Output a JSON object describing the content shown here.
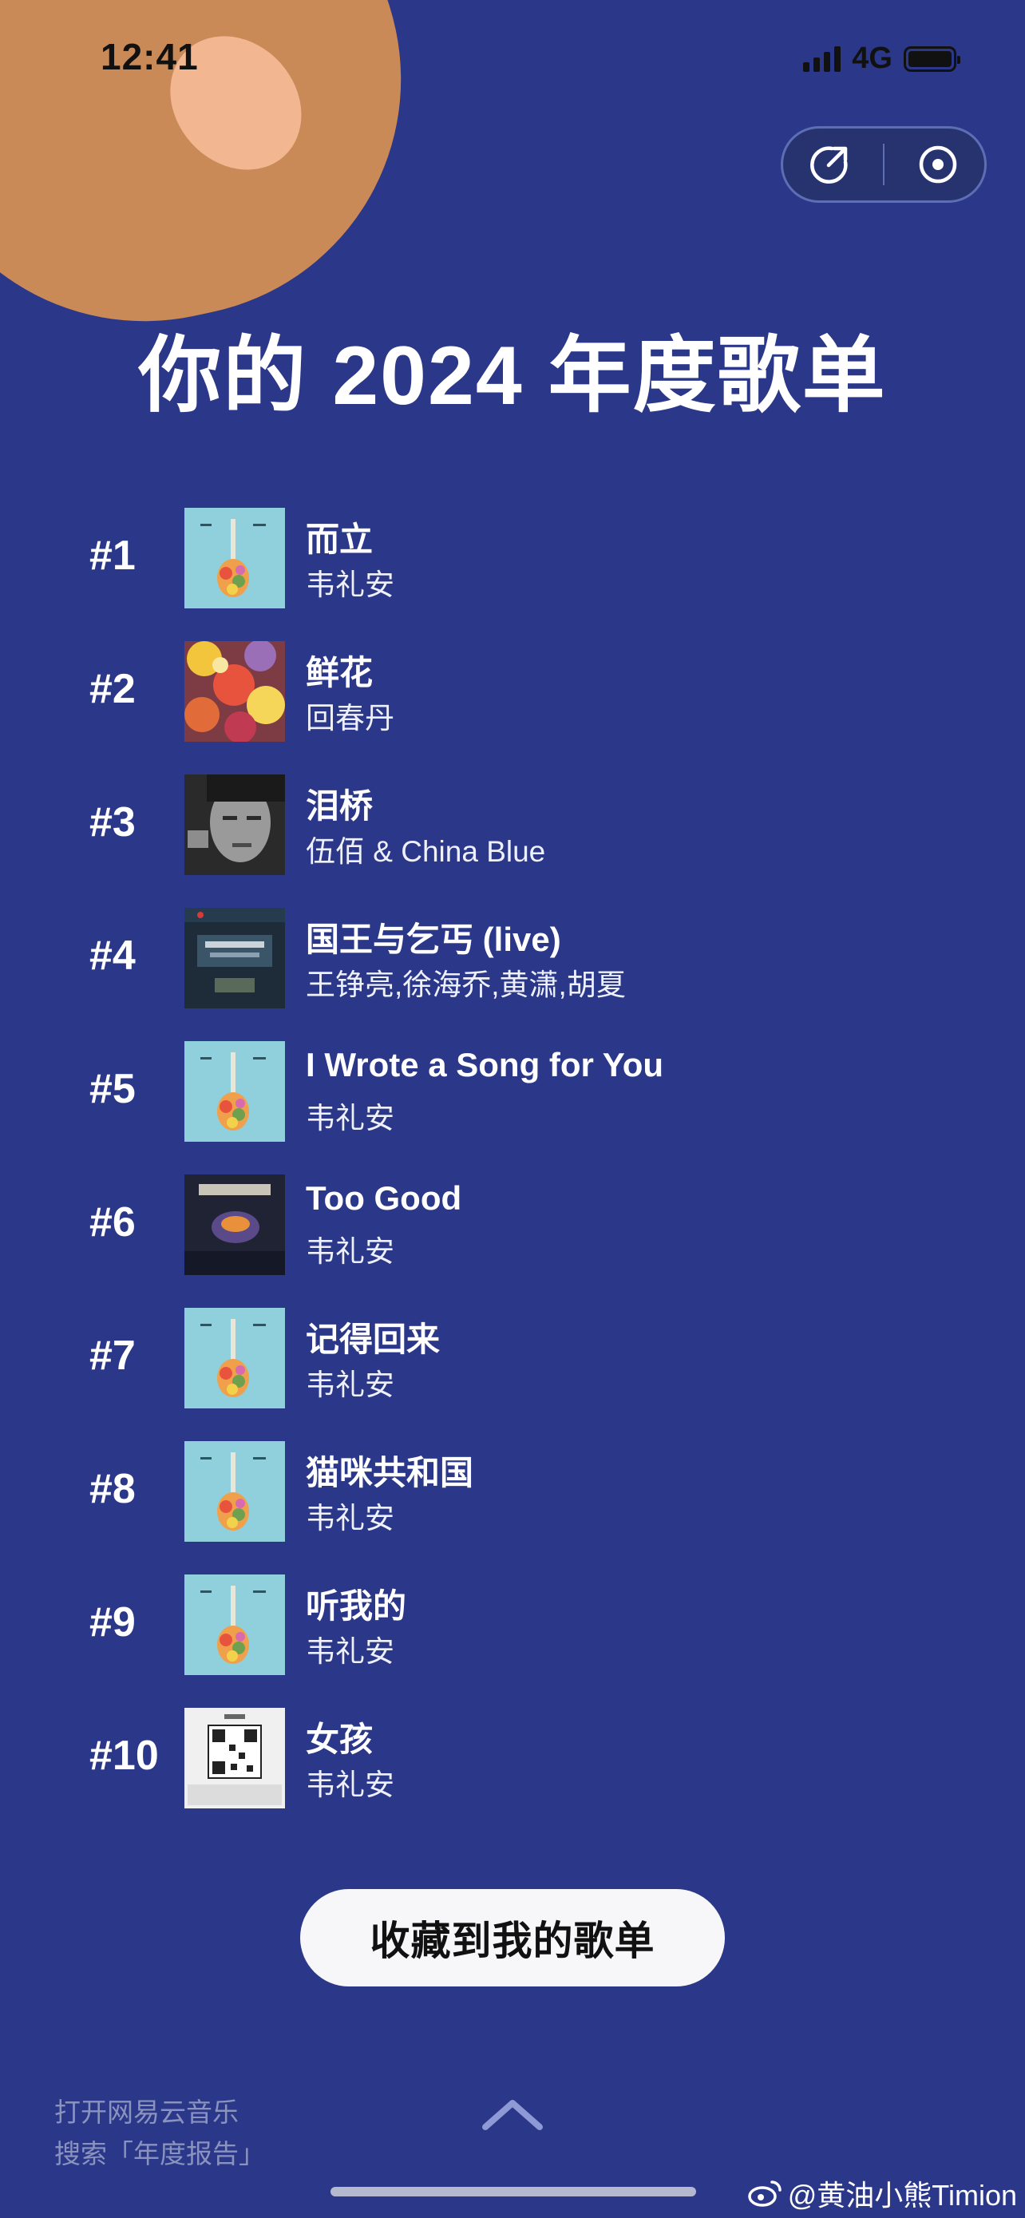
{
  "status_bar": {
    "time": "12:41",
    "network": "4G"
  },
  "capsule": {
    "share_icon": "share-icon",
    "close_icon": "record-icon"
  },
  "title": "你的 2024 年度歌单",
  "tracks": [
    {
      "rank": "#1",
      "song": "而立",
      "artist": "韦礼安",
      "cover": "guitar-cover"
    },
    {
      "rank": "#2",
      "song": "鲜花",
      "artist": "回春丹",
      "cover": "flowers-cover"
    },
    {
      "rank": "#3",
      "song": "泪桥",
      "artist": "伍佰 & China Blue",
      "cover": "portrait-cover"
    },
    {
      "rank": "#4",
      "song": "国王与乞丐 (live)",
      "artist": "王铮亮,徐海乔,黄潇,胡夏",
      "cover": "show-cover"
    },
    {
      "rank": "#5",
      "song": "I Wrote a Song for You",
      "artist": "韦礼安",
      "cover": "guitar-cover"
    },
    {
      "rank": "#6",
      "song": "Too Good",
      "artist": "韦礼安",
      "cover": "too-good-cover"
    },
    {
      "rank": "#7",
      "song": "记得回来",
      "artist": "韦礼安",
      "cover": "guitar-cover"
    },
    {
      "rank": "#8",
      "song": "猫咪共和国",
      "artist": "韦礼安",
      "cover": "guitar-cover"
    },
    {
      "rank": "#9",
      "song": "听我的",
      "artist": "韦礼安",
      "cover": "guitar-cover"
    },
    {
      "rank": "#10",
      "song": "女孩",
      "artist": "韦礼安",
      "cover": "qr-cover"
    }
  ],
  "save_button": "收藏到我的歌单",
  "hint": {
    "line1": "打开网易云音乐",
    "line2": "搜索「年度报告」"
  },
  "watermark": "@黄油小熊Timion",
  "colors": {
    "background": "#2b3788",
    "button": "#f7f7f9",
    "paw": "#c98a57"
  }
}
